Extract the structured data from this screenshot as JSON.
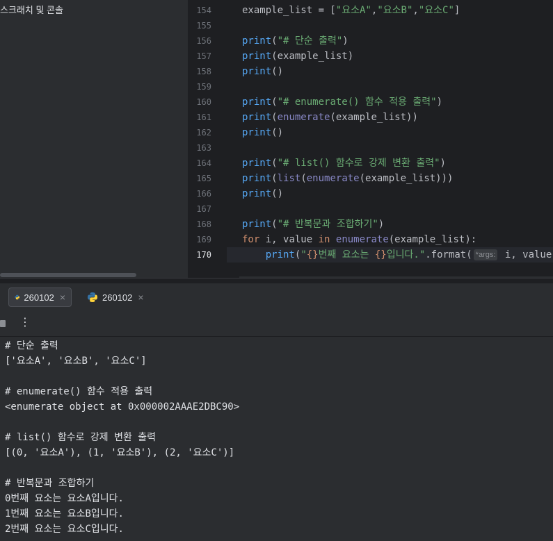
{
  "left_pane": {
    "scratch_label": "스크래치 및 콘솔"
  },
  "editor": {
    "active_line": "170",
    "line_numbers": [
      "154",
      "155",
      "156",
      "157",
      "158",
      "159",
      "160",
      "161",
      "162",
      "163",
      "164",
      "165",
      "166",
      "167",
      "168",
      "169",
      "170"
    ],
    "lines": {
      "l154": {
        "a": "example_list = [",
        "b": "\"요소A\"",
        "c": ",",
        "d": "\"요소B\"",
        "e": ",",
        "f": "\"요소C\"",
        "g": "]"
      },
      "l156": {
        "fn": "print",
        "open": "(",
        "str": "\"# 단순 출력\"",
        "close": ")"
      },
      "l157": {
        "fn": "print",
        "rest": "(example_list)"
      },
      "l158": {
        "fn": "print",
        "rest": "()"
      },
      "l160": {
        "fn": "print",
        "open": "(",
        "str": "\"# enumerate() 함수 적용 출력\"",
        "close": ")"
      },
      "l161": {
        "fn": "print",
        "open": "(",
        "builtin": "enumerate",
        "rest": "(example_list))"
      },
      "l162": {
        "fn": "print",
        "rest": "()"
      },
      "l164": {
        "fn": "print",
        "open": "(",
        "str": "\"# list() 함수로 강제 변환 출력\"",
        "close": ")"
      },
      "l165": {
        "fn": "print",
        "open": "(",
        "builtin1": "list",
        "mid": "(",
        "builtin2": "enumerate",
        "rest": "(example_list)))"
      },
      "l166": {
        "fn": "print",
        "rest": "()"
      },
      "l168": {
        "fn": "print",
        "open": "(",
        "str": "\"# 반복문과 조합하기\"",
        "close": ")"
      },
      "l169": {
        "kw1": "for",
        "mid1": " i, value ",
        "kw2": "in",
        "sp": " ",
        "builtin": "enumerate",
        "rest": "(example_list):"
      },
      "l170": {
        "indent": "    ",
        "fn": "print",
        "open": "(",
        "s1": "\"",
        "b1": "{}",
        "s2": "번째 요소는 ",
        "b2": "{}",
        "s3": "입니다.\"",
        "dot": ".format(",
        "hint": "*args:",
        "rest": " i, value))"
      }
    }
  },
  "run_tabs": [
    {
      "label": "260102",
      "close": "×"
    },
    {
      "label": "260102",
      "close": "×"
    }
  ],
  "toolbar": {
    "more": "⋮"
  },
  "console_output": [
    "# 단순 출력",
    "['요소A', '요소B', '요소C']",
    "",
    "# enumerate() 함수 적용 출력",
    "<enumerate object at 0x000002AAAE2DBC90>",
    "",
    "# list() 함수로 강제 변환 출력",
    "[(0, '요소A'), (1, '요소B'), (2, '요소C')]",
    "",
    "# 반복문과 조합하기",
    "0번째 요소는 요소A입니다.",
    "1번째 요소는 요소B입니다.",
    "2번째 요소는 요소C입니다."
  ],
  "colors": {
    "keyword": "#cf8e6d",
    "function": "#56a8f5",
    "builtin": "#8888c6",
    "string": "#6aab73",
    "python_blue": "#3572a5",
    "python_yellow": "#ffd43b"
  }
}
